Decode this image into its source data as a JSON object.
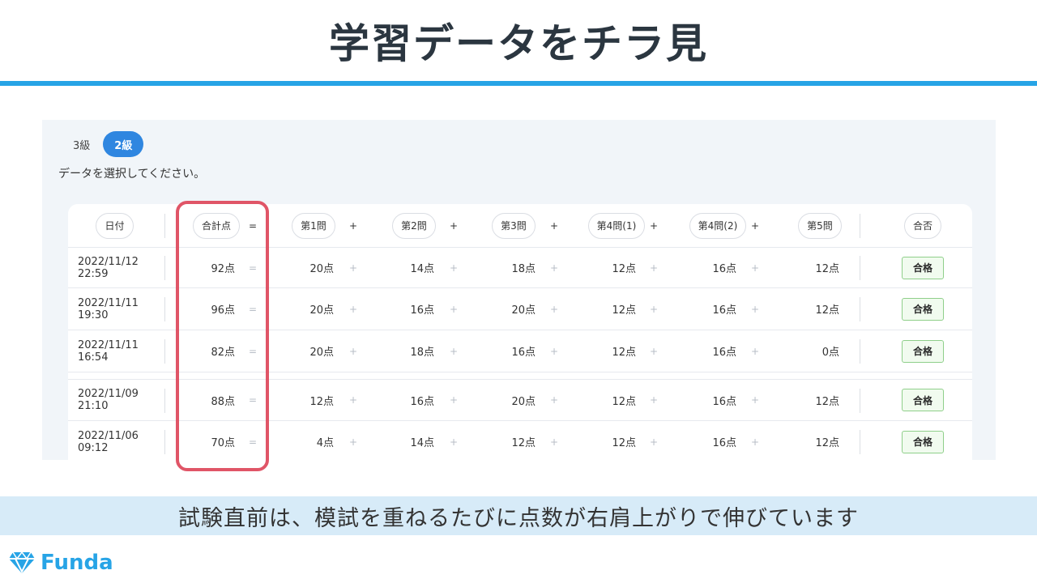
{
  "slide": {
    "title": "学習データをチラ見",
    "caption": "試験直前は、模試を重ねるたびに点数が右肩上がりで伸びています",
    "brand": "Funda"
  },
  "tabs": [
    {
      "label": "3級",
      "active": false
    },
    {
      "label": "2級",
      "active": true
    }
  ],
  "hint": "データを選択してください。",
  "table": {
    "headers": {
      "date": "日付",
      "total": "合計点",
      "eq": "=",
      "q1": "第1問",
      "q2": "第2問",
      "q3": "第3問",
      "q4a": "第4問(1)",
      "q4b": "第4問(2)",
      "q5": "第5問",
      "plus": "+",
      "result": "合否"
    },
    "rows": [
      {
        "date": "2022/11/12 22:59",
        "total": "92点",
        "q1": "20点",
        "q2": "14点",
        "q3": "18点",
        "q4a": "12点",
        "q4b": "16点",
        "q5": "12点",
        "result": "合格"
      },
      {
        "date": "2022/11/11 19:30",
        "total": "96点",
        "q1": "20点",
        "q2": "16点",
        "q3": "20点",
        "q4a": "12点",
        "q4b": "16点",
        "q5": "12点",
        "result": "合格"
      },
      {
        "date": "2022/11/11 16:54",
        "total": "82点",
        "q1": "20点",
        "q2": "18点",
        "q3": "16点",
        "q4a": "12点",
        "q4b": "16点",
        "q5": "0点",
        "result": "合格"
      },
      {
        "date": "2022/11/09 21:10",
        "total": "88点",
        "q1": "12点",
        "q2": "16点",
        "q3": "20点",
        "q4a": "12点",
        "q4b": "16点",
        "q5": "12点",
        "result": "合格"
      },
      {
        "date": "2022/11/06 09:12",
        "total": "70点",
        "q1": "4点",
        "q2": "14点",
        "q3": "12点",
        "q4a": "12点",
        "q4b": "16点",
        "q5": "12点",
        "result": "合格"
      }
    ]
  },
  "colors": {
    "accent": "#27a4e6",
    "active_tab": "#2f86e0",
    "highlight": "#e05567",
    "pass_border": "#8fcf8a",
    "caption_bg": "#d7ebf8"
  }
}
